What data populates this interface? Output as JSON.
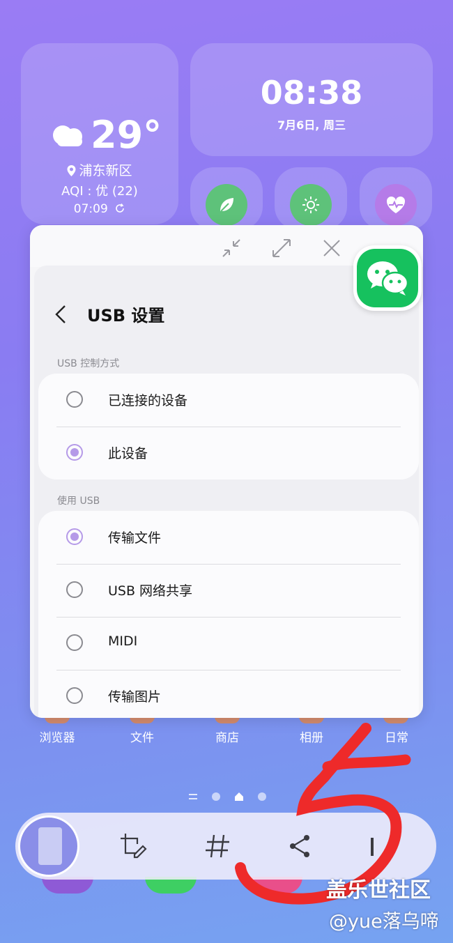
{
  "weather": {
    "temperature": "29°",
    "location": "浦东新区",
    "aqi": "AQI : 优 (22)",
    "updated_time": "07:09"
  },
  "clock": {
    "time": "08:38",
    "date": "7月6日, 周三"
  },
  "popup": {
    "title": "USB 设置",
    "section_control": "USB 控制方式",
    "control_options": [
      {
        "label": "已连接的设备",
        "selected": false
      },
      {
        "label": "此设备",
        "selected": true
      }
    ],
    "section_use": "使用 USB",
    "use_options": [
      {
        "label": "传输文件",
        "selected": true
      },
      {
        "label": "USB 网络共享",
        "selected": false
      },
      {
        "label": "MIDI",
        "selected": false
      },
      {
        "label": "传输图片",
        "selected": false
      }
    ]
  },
  "apps": [
    "浏览器",
    "文件",
    "商店",
    "相册",
    "日常"
  ],
  "watermark": {
    "line1": "盖乐世社区",
    "line2": "@yue落乌啼"
  },
  "colors": {
    "accent_radio": "#b59ae8",
    "wechat_green": "#16c15e",
    "annotation_red": "#ee2a2a"
  },
  "icons": [
    "cloud-icon",
    "location-pin-icon",
    "refresh-icon",
    "leaf-icon",
    "brightness-icon",
    "heart-rate-icon",
    "minimize-icon",
    "maximize-icon",
    "close-icon",
    "back-icon",
    "wechat-icon",
    "crop-edit-icon",
    "hashtag-icon",
    "share-icon"
  ]
}
